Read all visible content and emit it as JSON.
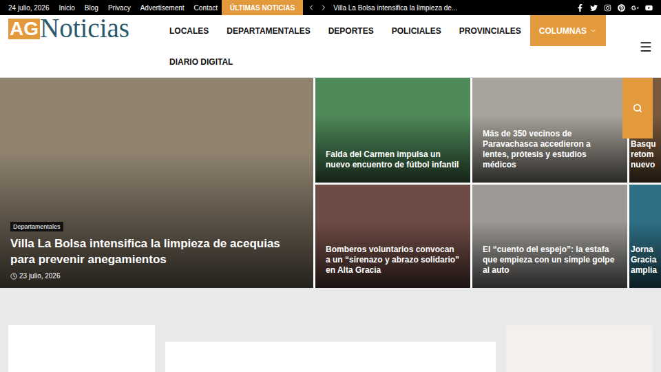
{
  "topbar": {
    "date": "24 julio, 2026",
    "links": [
      "Inicio",
      "Blog",
      "Privacy",
      "Advertisement",
      "Contact"
    ],
    "latest_label": "ÚLTIMAS NOTICIAS",
    "ticker": "Villa La Bolsa intensifica la limpieza de..."
  },
  "logo": {
    "prefix": "AG",
    "name": "Noticias"
  },
  "nav": [
    {
      "label": "LOCALES",
      "selected": false,
      "has_menu": false
    },
    {
      "label": "DEPARTAMENTALES",
      "selected": false,
      "has_menu": false
    },
    {
      "label": "DEPORTES",
      "selected": false,
      "has_menu": false
    },
    {
      "label": "POLICIALES",
      "selected": false,
      "has_menu": false
    },
    {
      "label": "PROVINCIALES",
      "selected": false,
      "has_menu": false
    },
    {
      "label": "COLUMNAS",
      "selected": true,
      "has_menu": true
    },
    {
      "label": "DIARIO DIGITAL",
      "selected": false,
      "has_menu": false
    }
  ],
  "hero": {
    "category": "Departamentales",
    "title": "Villa La Bolsa intensifica la limpieza de acequias para prevenir anegamientos",
    "date": "23 julio, 2026",
    "color": "#8f826f"
  },
  "cards": [
    {
      "kind": "full",
      "title": "Falda del Carmen impulsa un nuevo encuentro de fútbol infantil",
      "color": "#4f8a5a"
    },
    {
      "kind": "full",
      "title": "Más de 350 vecinos de Paravachasca accedieron a lentes, prótesis y estudios médicos",
      "color": "#a9a49b"
    },
    {
      "kind": "cut",
      "title": "Basqu\nretom\nnuevo",
      "color": "#7a5a3c"
    },
    {
      "kind": "full",
      "title": "Bomberos voluntarios convocan a un “sirenazo y abrazo solidario” en Alta Gracia",
      "color": "#6e4b44"
    },
    {
      "kind": "full",
      "title": "El “cuento del espejo”: la estafa que empieza con un simple golpe al auto",
      "color": "#9c9995"
    },
    {
      "kind": "cut",
      "title": "Jorna\nGracia\namplia",
      "color": "#2f6f86"
    }
  ]
}
